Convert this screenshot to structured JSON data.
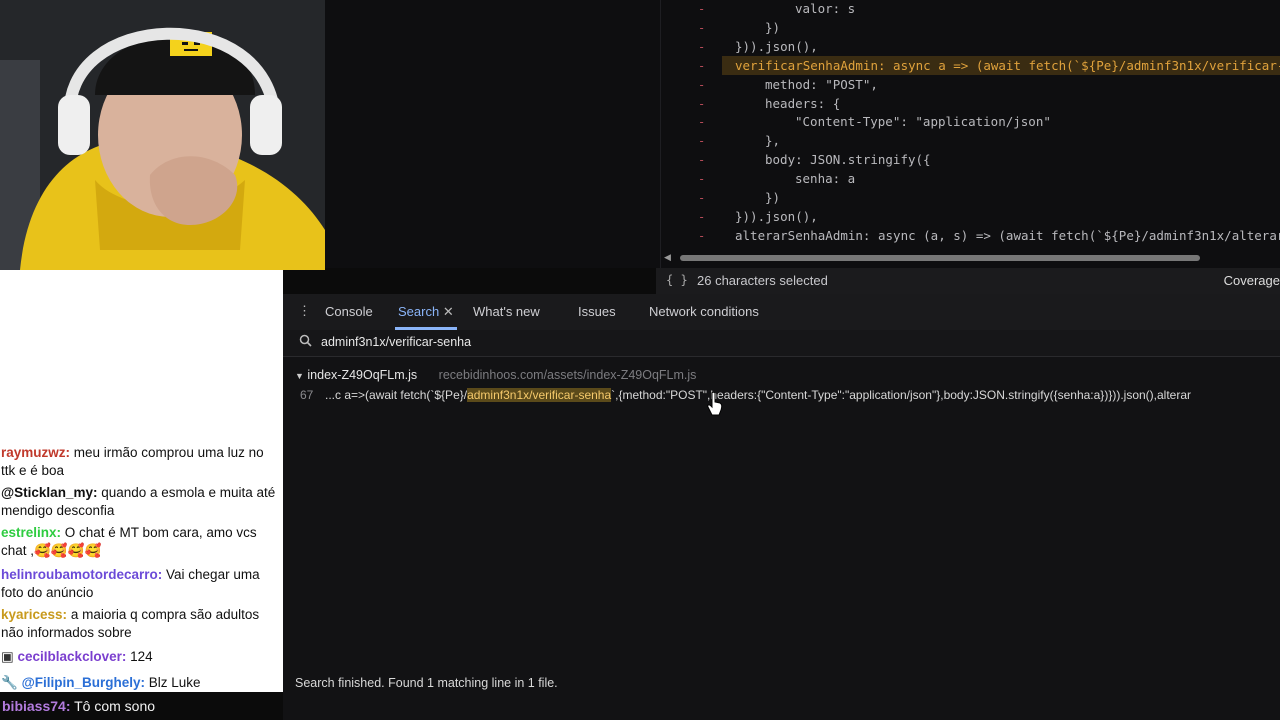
{
  "editor": {
    "lines": [
      {
        "text": "valor: s",
        "indent": 2
      },
      {
        "text": "})",
        "indent": 1
      },
      {
        "text": "})).json(),",
        "indent": 0
      },
      {
        "text": "verificarSenhaAdmin: async a => (await fetch(`${Pe}/adminf3n1x/verificar-",
        "indent": 0,
        "highlight": true
      },
      {
        "text": "method: \"POST\",",
        "indent": 1
      },
      {
        "text": "headers: {",
        "indent": 1
      },
      {
        "text": "\"Content-Type\": \"application/json\"",
        "indent": 2
      },
      {
        "text": "},",
        "indent": 1
      },
      {
        "text": "body: JSON.stringify({",
        "indent": 1
      },
      {
        "text": "senha: a",
        "indent": 2
      },
      {
        "text": "})",
        "indent": 1
      },
      {
        "text": "})).json(),",
        "indent": 0
      },
      {
        "text": "alterarSenhaAdmin: async (a, s) => (await fetch(`${Pe}/adminf3n1x/alterar",
        "indent": 0
      }
    ]
  },
  "statusbar": {
    "braces": "{ }",
    "selection": "26 characters selected",
    "coverage": "Coverage"
  },
  "chat": {
    "messages": [
      {
        "user": "raymuzwz:",
        "text": " meu irmão comprou uma luz no ttk e é boa",
        "color": "#c0392b"
      },
      {
        "user": "@Sticklan_my:",
        "text": " quando a esmola e muita até mendigo desconfia",
        "color": "#111111"
      },
      {
        "user": "estrelinx:",
        "text": " O chat é MT bom cara, amo vcs chat ,🥰🥰🥰🥰",
        "color": "#2ecc40"
      },
      {
        "user": "helinroubamotordecarro:",
        "text": " Vai chegar uma foto do anúncio",
        "color": "#6c4bd8"
      },
      {
        "user": "kyaricess:",
        "text": " a maioria q compra são adultos não informados sobre",
        "color": "#c89a1d"
      },
      {
        "user": "ceciIblackclover:",
        "text": " 124",
        "color": "#7b3fcf"
      },
      {
        "user": "@Filipin_Burghely:",
        "text": " Blz Luke",
        "color": "#2b6fd6"
      }
    ],
    "bottom": {
      "user": "bibiass74:",
      "text": " Tô com sono"
    }
  },
  "devtools": {
    "tabs": [
      "Console",
      "Search",
      "What's new",
      "Issues",
      "Network conditions"
    ],
    "active_tab": "Search",
    "search_query": "adminf3n1x/verificar-senha",
    "result_file": "index-Z49OqFLm.js",
    "result_path": "recebidinhoos.com/assets/index-Z49OqFLm.js",
    "result_line_number": "67",
    "result_prefix": "...c a=>(await fetch(`${Pe}/",
    "result_match": "adminf3n1x/verificar-senha",
    "result_suffix": "`,{method:\"POST\",headers:{\"Content-Type\":\"application/json\"},body:JSON.stringify({senha:a})})).json(),alterar",
    "status": "Search finished.  Found 1 matching line in 1 file."
  },
  "colors": {
    "accent": "#8ab4f8",
    "highlight": "#5b4a1a",
    "code_key": "#e0a23c"
  }
}
